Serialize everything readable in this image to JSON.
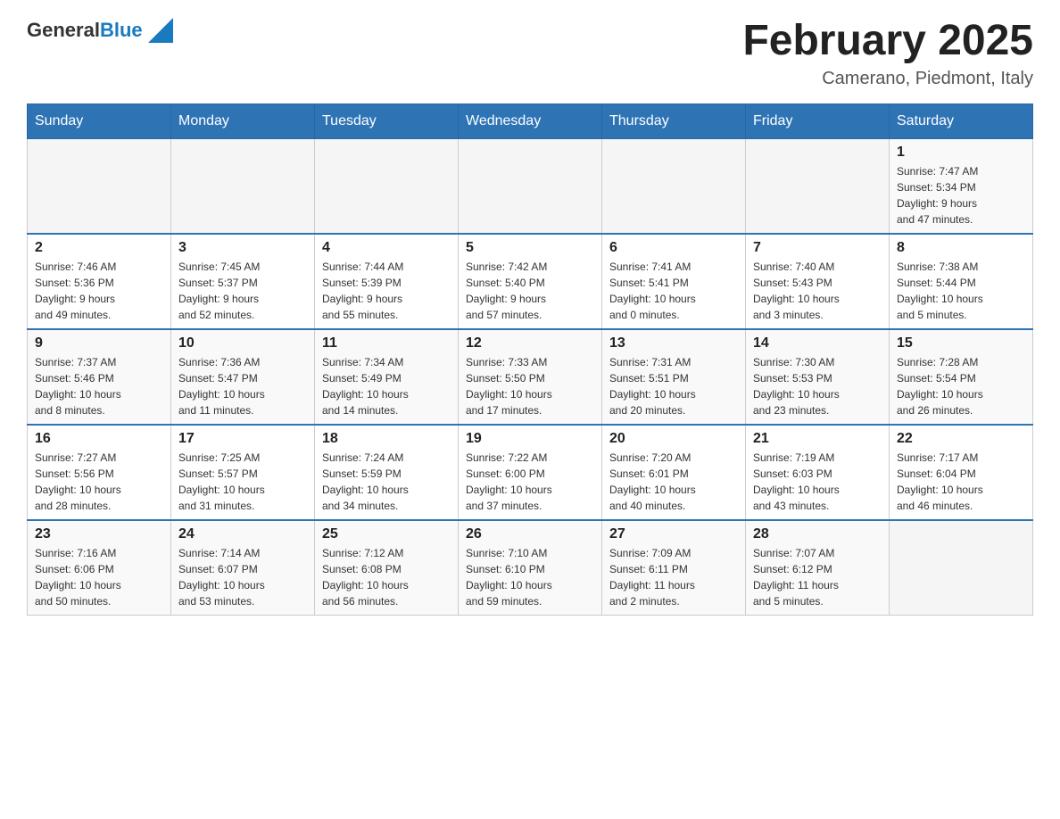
{
  "header": {
    "logo_text_general": "General",
    "logo_text_blue": "Blue",
    "month_title": "February 2025",
    "location": "Camerano, Piedmont, Italy"
  },
  "days_of_week": [
    "Sunday",
    "Monday",
    "Tuesday",
    "Wednesday",
    "Thursday",
    "Friday",
    "Saturday"
  ],
  "weeks": [
    {
      "days": [
        {
          "number": "",
          "info": ""
        },
        {
          "number": "",
          "info": ""
        },
        {
          "number": "",
          "info": ""
        },
        {
          "number": "",
          "info": ""
        },
        {
          "number": "",
          "info": ""
        },
        {
          "number": "",
          "info": ""
        },
        {
          "number": "1",
          "info": "Sunrise: 7:47 AM\nSunset: 5:34 PM\nDaylight: 9 hours\nand 47 minutes."
        }
      ]
    },
    {
      "days": [
        {
          "number": "2",
          "info": "Sunrise: 7:46 AM\nSunset: 5:36 PM\nDaylight: 9 hours\nand 49 minutes."
        },
        {
          "number": "3",
          "info": "Sunrise: 7:45 AM\nSunset: 5:37 PM\nDaylight: 9 hours\nand 52 minutes."
        },
        {
          "number": "4",
          "info": "Sunrise: 7:44 AM\nSunset: 5:39 PM\nDaylight: 9 hours\nand 55 minutes."
        },
        {
          "number": "5",
          "info": "Sunrise: 7:42 AM\nSunset: 5:40 PM\nDaylight: 9 hours\nand 57 minutes."
        },
        {
          "number": "6",
          "info": "Sunrise: 7:41 AM\nSunset: 5:41 PM\nDaylight: 10 hours\nand 0 minutes."
        },
        {
          "number": "7",
          "info": "Sunrise: 7:40 AM\nSunset: 5:43 PM\nDaylight: 10 hours\nand 3 minutes."
        },
        {
          "number": "8",
          "info": "Sunrise: 7:38 AM\nSunset: 5:44 PM\nDaylight: 10 hours\nand 5 minutes."
        }
      ]
    },
    {
      "days": [
        {
          "number": "9",
          "info": "Sunrise: 7:37 AM\nSunset: 5:46 PM\nDaylight: 10 hours\nand 8 minutes."
        },
        {
          "number": "10",
          "info": "Sunrise: 7:36 AM\nSunset: 5:47 PM\nDaylight: 10 hours\nand 11 minutes."
        },
        {
          "number": "11",
          "info": "Sunrise: 7:34 AM\nSunset: 5:49 PM\nDaylight: 10 hours\nand 14 minutes."
        },
        {
          "number": "12",
          "info": "Sunrise: 7:33 AM\nSunset: 5:50 PM\nDaylight: 10 hours\nand 17 minutes."
        },
        {
          "number": "13",
          "info": "Sunrise: 7:31 AM\nSunset: 5:51 PM\nDaylight: 10 hours\nand 20 minutes."
        },
        {
          "number": "14",
          "info": "Sunrise: 7:30 AM\nSunset: 5:53 PM\nDaylight: 10 hours\nand 23 minutes."
        },
        {
          "number": "15",
          "info": "Sunrise: 7:28 AM\nSunset: 5:54 PM\nDaylight: 10 hours\nand 26 minutes."
        }
      ]
    },
    {
      "days": [
        {
          "number": "16",
          "info": "Sunrise: 7:27 AM\nSunset: 5:56 PM\nDaylight: 10 hours\nand 28 minutes."
        },
        {
          "number": "17",
          "info": "Sunrise: 7:25 AM\nSunset: 5:57 PM\nDaylight: 10 hours\nand 31 minutes."
        },
        {
          "number": "18",
          "info": "Sunrise: 7:24 AM\nSunset: 5:59 PM\nDaylight: 10 hours\nand 34 minutes."
        },
        {
          "number": "19",
          "info": "Sunrise: 7:22 AM\nSunset: 6:00 PM\nDaylight: 10 hours\nand 37 minutes."
        },
        {
          "number": "20",
          "info": "Sunrise: 7:20 AM\nSunset: 6:01 PM\nDaylight: 10 hours\nand 40 minutes."
        },
        {
          "number": "21",
          "info": "Sunrise: 7:19 AM\nSunset: 6:03 PM\nDaylight: 10 hours\nand 43 minutes."
        },
        {
          "number": "22",
          "info": "Sunrise: 7:17 AM\nSunset: 6:04 PM\nDaylight: 10 hours\nand 46 minutes."
        }
      ]
    },
    {
      "days": [
        {
          "number": "23",
          "info": "Sunrise: 7:16 AM\nSunset: 6:06 PM\nDaylight: 10 hours\nand 50 minutes."
        },
        {
          "number": "24",
          "info": "Sunrise: 7:14 AM\nSunset: 6:07 PM\nDaylight: 10 hours\nand 53 minutes."
        },
        {
          "number": "25",
          "info": "Sunrise: 7:12 AM\nSunset: 6:08 PM\nDaylight: 10 hours\nand 56 minutes."
        },
        {
          "number": "26",
          "info": "Sunrise: 7:10 AM\nSunset: 6:10 PM\nDaylight: 10 hours\nand 59 minutes."
        },
        {
          "number": "27",
          "info": "Sunrise: 7:09 AM\nSunset: 6:11 PM\nDaylight: 11 hours\nand 2 minutes."
        },
        {
          "number": "28",
          "info": "Sunrise: 7:07 AM\nSunset: 6:12 PM\nDaylight: 11 hours\nand 5 minutes."
        },
        {
          "number": "",
          "info": ""
        }
      ]
    }
  ]
}
